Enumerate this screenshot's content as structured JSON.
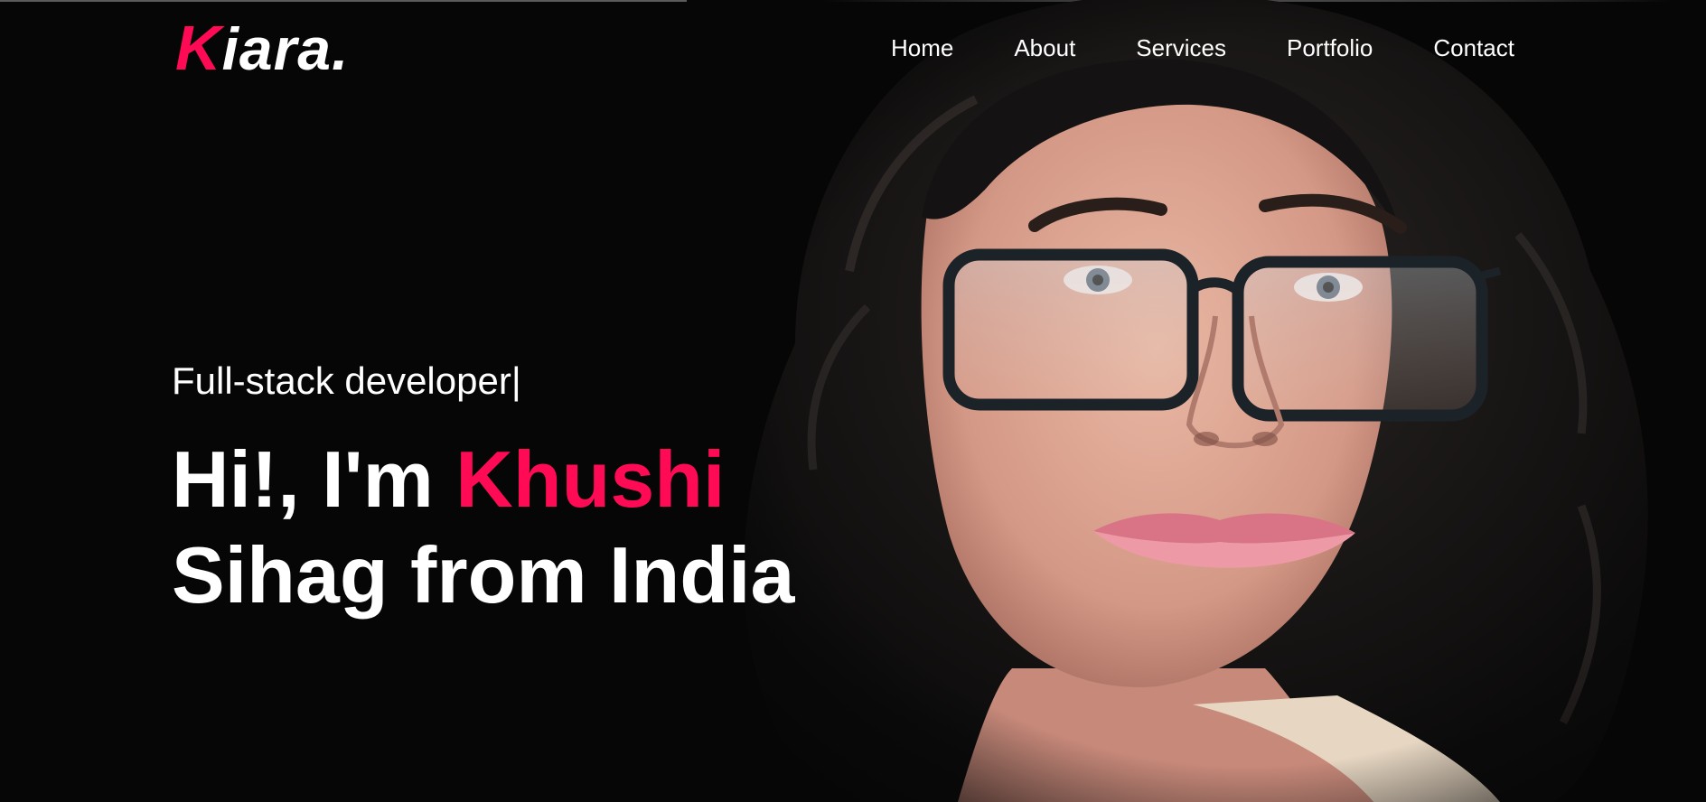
{
  "brand": {
    "logo_first_letter": "K",
    "logo_rest": "iara.",
    "accent_color": "#ff0a55"
  },
  "nav": {
    "items": [
      {
        "label": "Home"
      },
      {
        "label": "About"
      },
      {
        "label": "Services"
      },
      {
        "label": "Portfolio"
      },
      {
        "label": "Contact"
      }
    ]
  },
  "hero": {
    "role": "Full-stack developer|",
    "greeting_prefix": "Hi!, I'm ",
    "name_highlight": "Khushi",
    "greeting_line2": "Sihag from India"
  },
  "portrait": {
    "icon": "portrait-photo"
  },
  "colors": {
    "background": "#060606",
    "text": "#ffffff",
    "accent": "#ff0a55"
  }
}
